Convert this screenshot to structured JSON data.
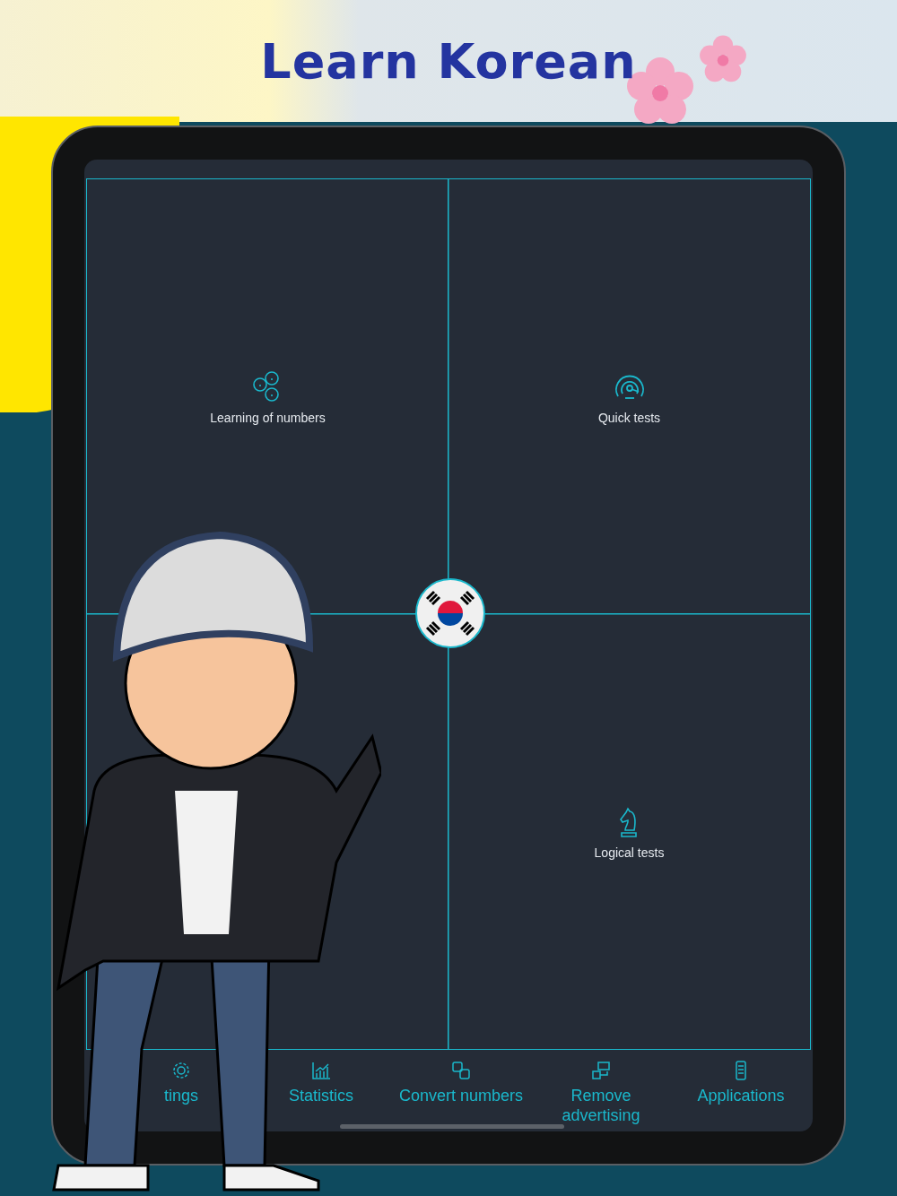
{
  "title": "Learn Korean",
  "tiles": [
    {
      "label": "Learning of numbers",
      "kind": "numbers"
    },
    {
      "label": "Quick tests",
      "kind": "gauge"
    },
    {
      "label": "Logical tests",
      "kind": "knight"
    }
  ],
  "tab_bar": [
    {
      "label": "tings",
      "kind": "gear"
    },
    {
      "label": "Statistics",
      "kind": "chart"
    },
    {
      "label": "Convert numbers",
      "kind": "convert"
    },
    {
      "label": "Remove advertising",
      "kind": "ads"
    },
    {
      "label": "Applications",
      "kind": "phone"
    }
  ]
}
